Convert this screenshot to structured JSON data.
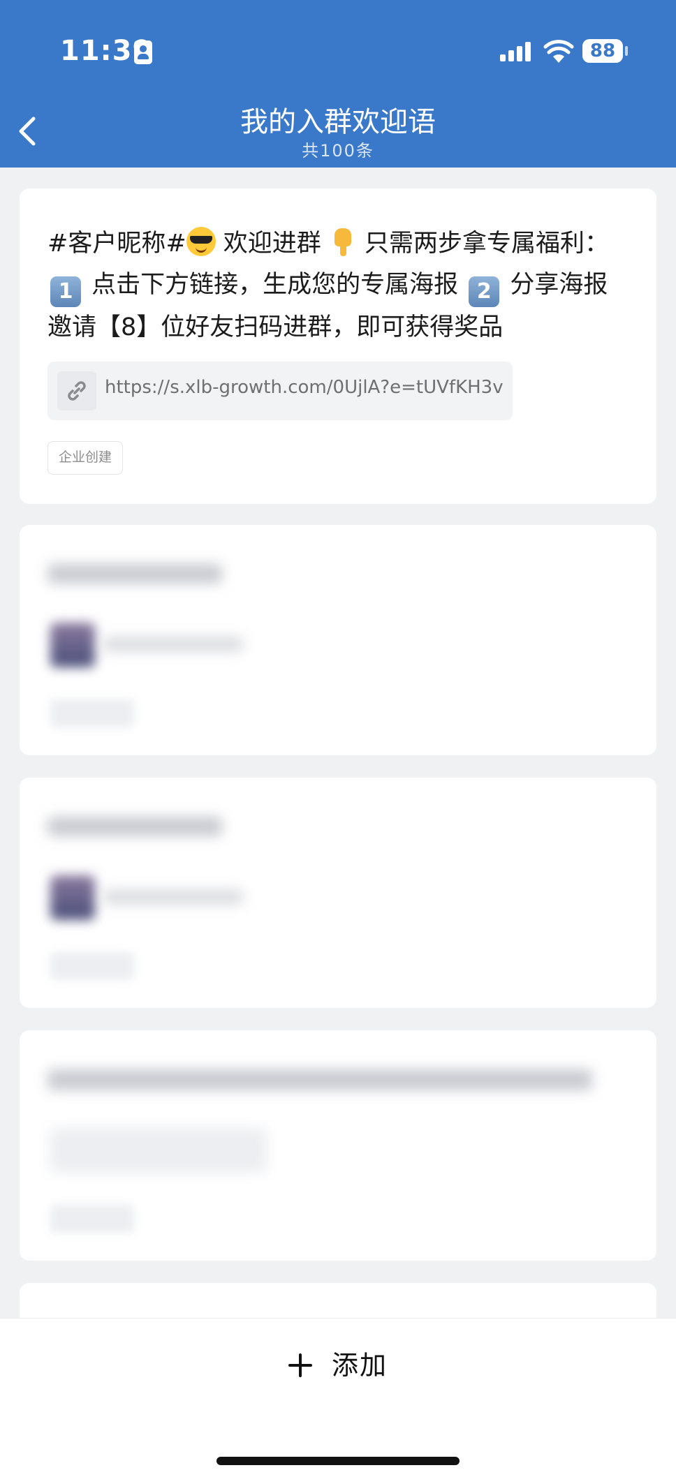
{
  "status_bar": {
    "time": "11:39",
    "battery": "88",
    "icons": [
      "contact-card-icon",
      "cellular-signal-icon",
      "wifi-icon",
      "battery-icon"
    ]
  },
  "nav": {
    "title": "我的入群欢迎语",
    "subtitle": "共100条",
    "back_icon": "chevron-left-icon"
  },
  "colors": {
    "header_bg": "#3a78c9",
    "page_bg": "#f0f1f3",
    "card_bg": "#ffffff"
  },
  "messages": [
    {
      "text_segments": [
        "#客户昵称#",
        " 欢迎进群 ",
        " 只需两步拿专属福利：",
        "1",
        " 点击下方链接，生成您的专属海报 ",
        "2",
        " 分享海报邀请【8】位好友扫码进群，即可获得奖品"
      ],
      "emoji": [
        "smiling-face-with-sunglasses",
        "backhand-index-pointing-down",
        "keycap-1",
        "keycap-2"
      ],
      "link": "https://s.xlb-growth.com/0UjlA?e=tUVfKH3v",
      "tag": "企业创建"
    }
  ],
  "footer": {
    "add_label": "添加",
    "add_icon": "plus-icon"
  }
}
